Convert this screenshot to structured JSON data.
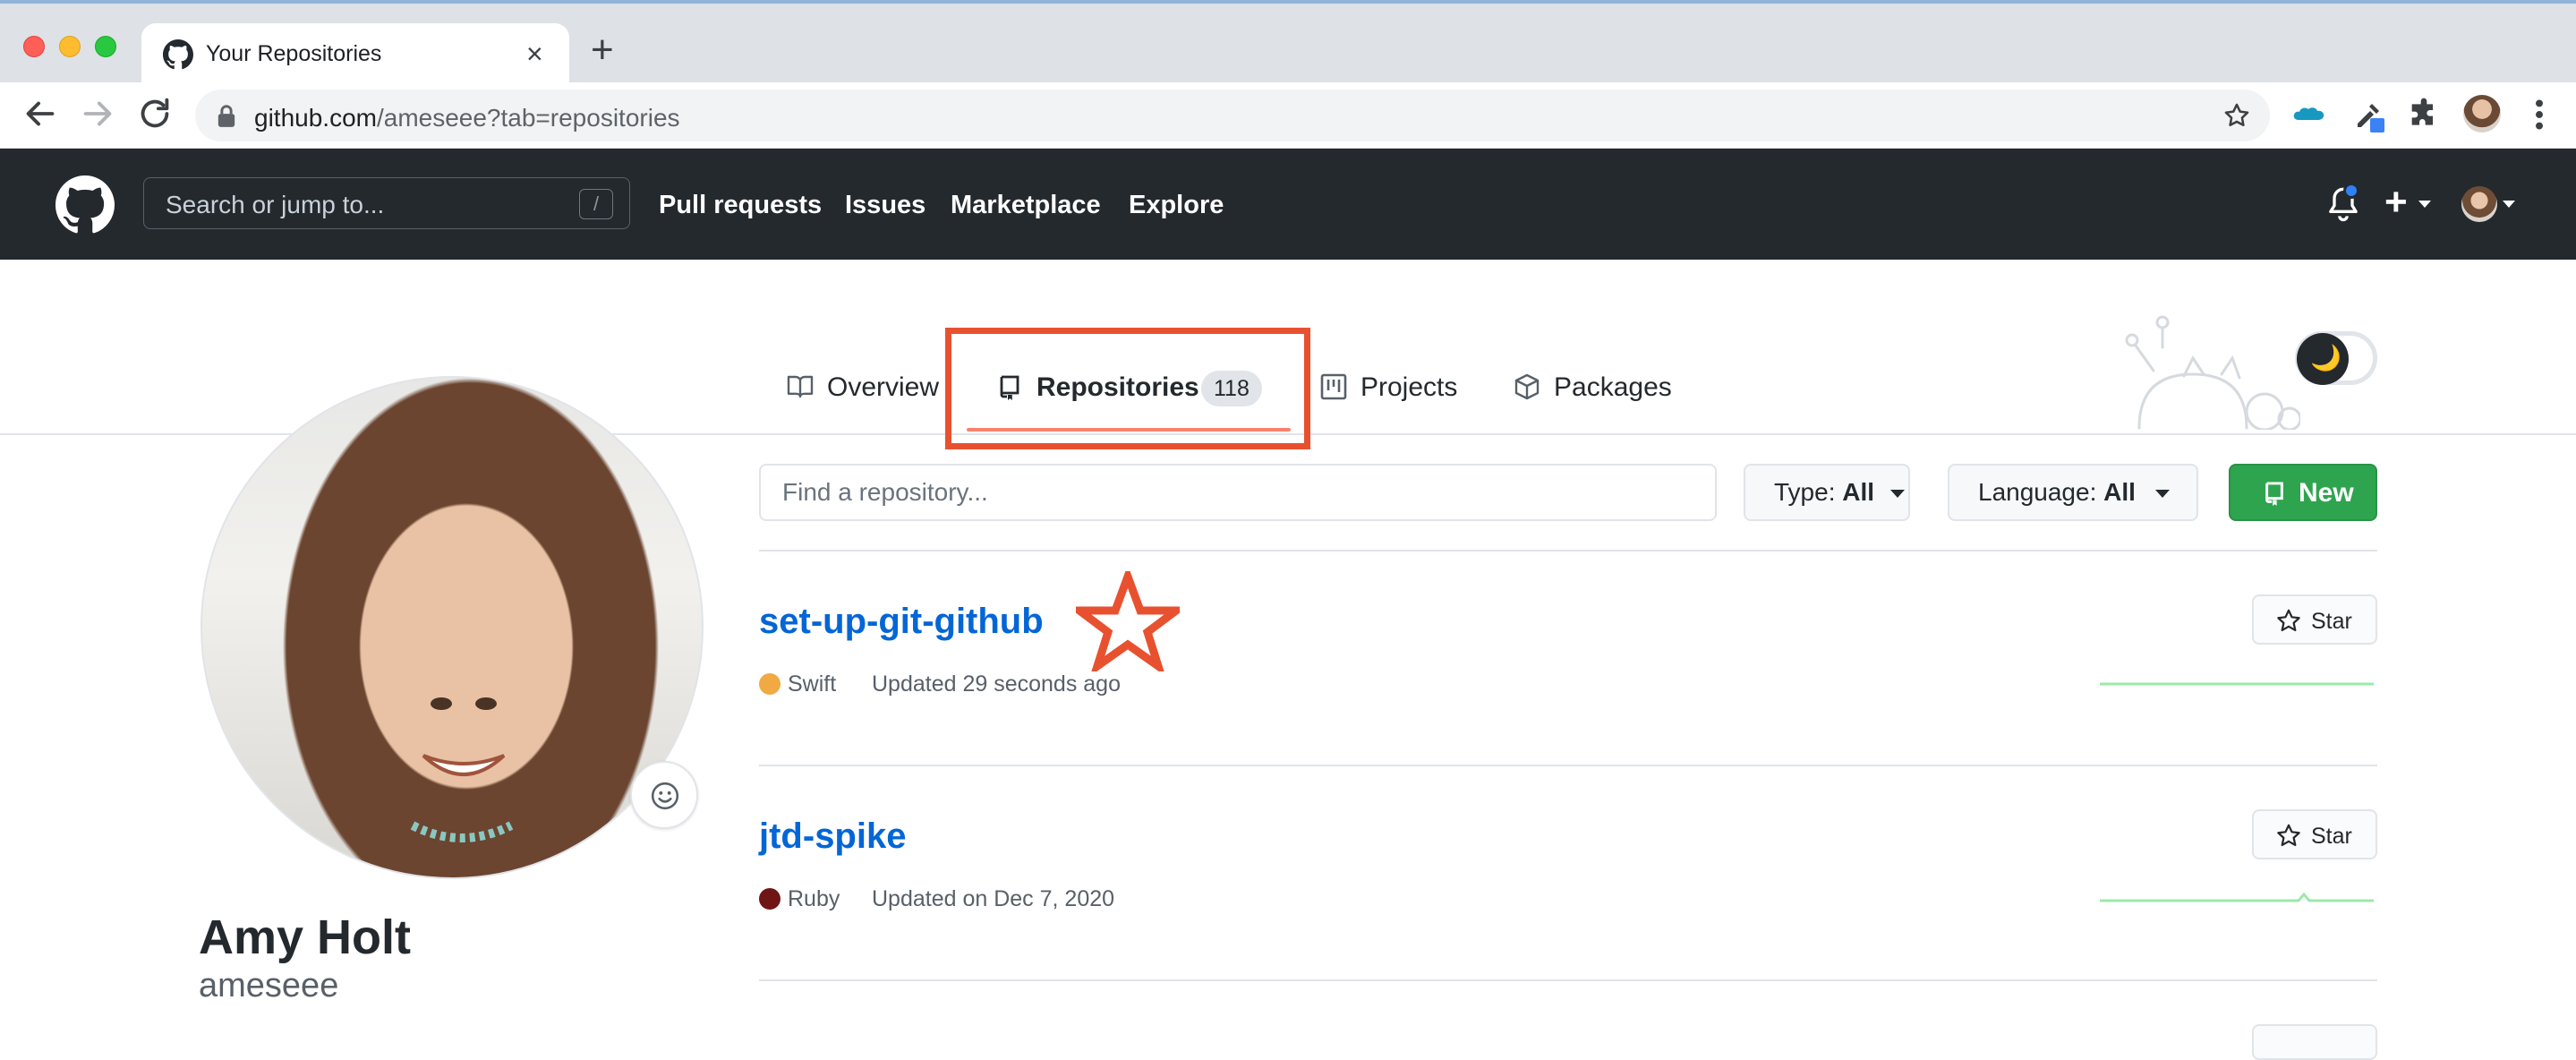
{
  "browser": {
    "tab_title": "Your Repositories",
    "tab_close": "×",
    "new_tab": "+",
    "url_host": "github.com",
    "url_path": "/ameseee?tab=repositories"
  },
  "header": {
    "search_placeholder": "Search or jump to...",
    "search_shortcut": "/",
    "nav": [
      "Pull requests",
      "Issues",
      "Marketplace",
      "Explore"
    ],
    "plus": "+"
  },
  "tabs": {
    "overview": "Overview",
    "repositories": "Repositories",
    "repositories_count": "118",
    "projects": "Projects",
    "packages": "Packages"
  },
  "theme_toggle": {
    "icon": "🌙"
  },
  "profile": {
    "full_name": "Amy Holt",
    "username": "ameseee"
  },
  "filters": {
    "search_placeholder": "Find a repository...",
    "type_label": "Type: ",
    "type_value": "All",
    "language_label": "Language: ",
    "language_value": "All",
    "new_label": "New"
  },
  "repos": [
    {
      "name": "set-up-git-github",
      "language": "Swift",
      "language_color": "#f1a944",
      "updated": "Updated 29 seconds ago",
      "star_label": "Star"
    },
    {
      "name": "jtd-spike",
      "language": "Ruby",
      "language_color": "#701516",
      "updated": "Updated on Dec 7, 2020",
      "star_label": "Star"
    }
  ],
  "colors": {
    "header_bg": "#24292e",
    "link": "#0366d6",
    "new_button": "#2ea44f",
    "tab_underline": "#f9826c",
    "annotation": "#e8512f"
  }
}
